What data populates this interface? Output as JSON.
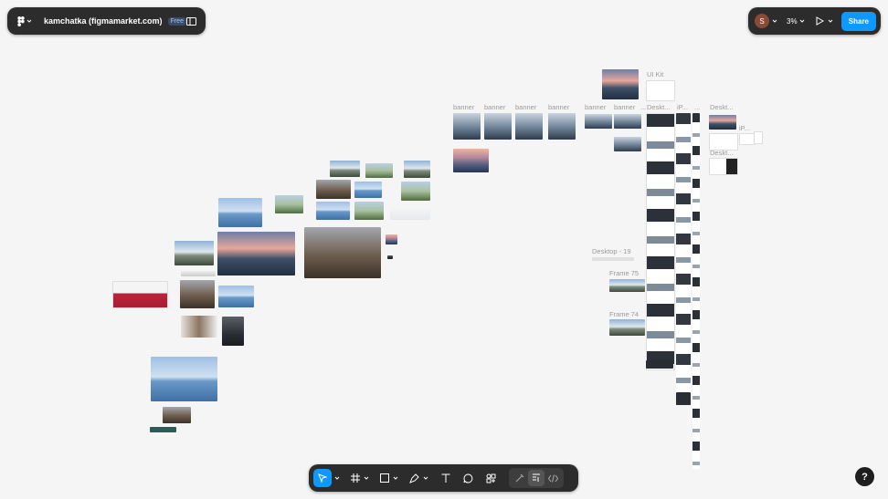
{
  "file": {
    "title": "kamchatka (figmamarket.com)",
    "plan_badge": "Free"
  },
  "header": {
    "avatar_initial": "S",
    "zoom": "3%",
    "share_label": "Share"
  },
  "canvas_labels": {
    "ui_kit": "UI Kit",
    "banner_1": "banner",
    "banner_2": "banner",
    "banner_3": "banner",
    "banner_4": "banner",
    "banner_5": "banner",
    "banner_6": "banner",
    "ellipsis_1": "...",
    "desktop_a": "Deskt...",
    "ip_a": "iP...",
    "ellipsis_2": "...",
    "desktop_b": "Deskt...",
    "ip_b": "iP...",
    "desktop_c": "Deskt...",
    "desktop_19": "Desktop - 19",
    "frame_75": "Frame 75",
    "frame_74": "Frame 74"
  },
  "toolbar": {
    "tools": [
      "move",
      "frame",
      "rectangle",
      "pen",
      "text",
      "comment",
      "actions"
    ],
    "modes": [
      "draw",
      "design",
      "dev"
    ]
  },
  "help_label": "?",
  "colors": {
    "panel": "#2c2c2c",
    "accent": "#0d99ff",
    "canvas": "#f5f5f5",
    "active_tool": "#0d99ff"
  }
}
